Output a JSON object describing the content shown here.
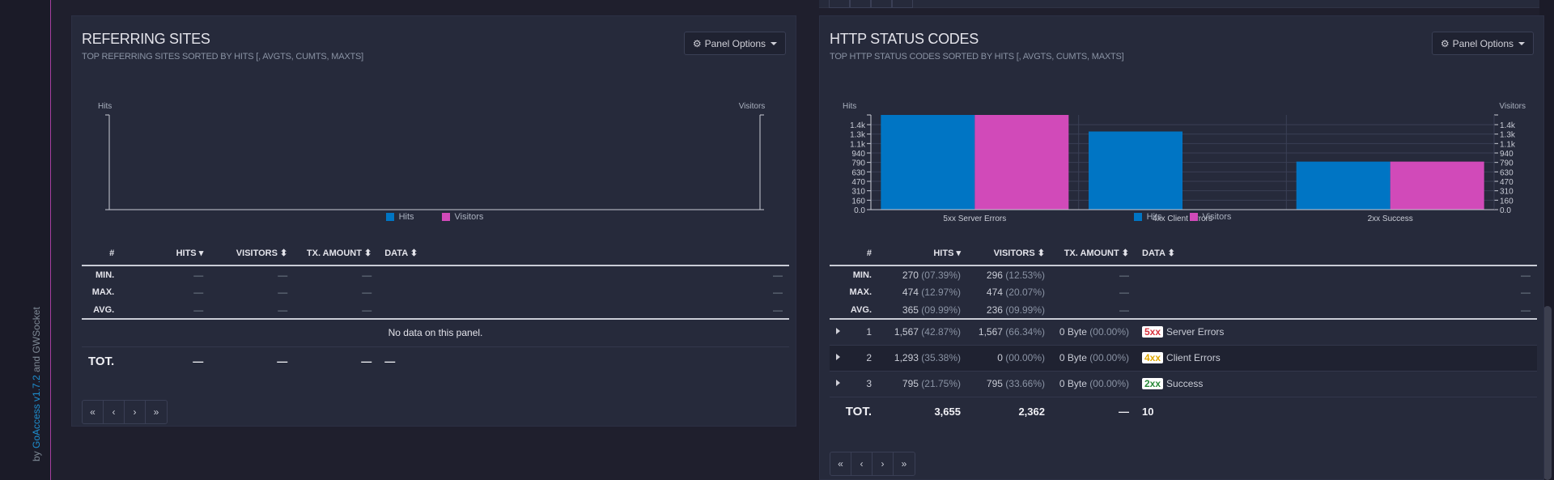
{
  "credit": {
    "prefix": "by ",
    "app": "GoAccess",
    "version": "v1.7.2",
    "and": " and ",
    "lib": "GWSocket"
  },
  "panel_options_label": "Panel Options",
  "colors": {
    "hits": "#0075c4",
    "visitors": "#d14ab9",
    "accent": "#a53fa0"
  },
  "pager": [
    "«",
    "‹",
    "›",
    "»"
  ],
  "referring": {
    "title": "REFERRING SITES",
    "subtitle": "TOP REFERRING SITES SORTED BY HITS [, AVGTS, CUMTS, MAXTS]",
    "axis_left": "Hits",
    "axis_right": "Visitors",
    "legend": [
      "Hits",
      "Visitors"
    ],
    "columns": [
      "#",
      "HITS",
      "VISITORS",
      "TX. AMOUNT",
      "DATA"
    ],
    "summary": [
      {
        "label": "MIN.",
        "hits": "—",
        "visitors": "—",
        "tx": "—",
        "end": "—"
      },
      {
        "label": "MAX.",
        "hits": "—",
        "visitors": "—",
        "tx": "—",
        "end": "—"
      },
      {
        "label": "AVG.",
        "hits": "—",
        "visitors": "—",
        "tx": "—",
        "end": "—"
      }
    ],
    "no_data": "No data on this panel.",
    "total": {
      "label": "TOT.",
      "hits": "—",
      "visitors": "—",
      "tx": "—",
      "data": "—"
    }
  },
  "http": {
    "title": "HTTP STATUS CODES",
    "subtitle": "TOP HTTP STATUS CODES SORTED BY HITS [, AVGTS, CUMTS, MAXTS]",
    "legend": [
      "Hits",
      "Visitors"
    ],
    "columns": [
      "#",
      "HITS",
      "VISITORS",
      "TX. AMOUNT",
      "DATA"
    ],
    "summary": [
      {
        "label": "MIN.",
        "hits": "270",
        "hits_pct": "(07.39%)",
        "visitors": "296",
        "visitors_pct": "(12.53%)",
        "tx": "—",
        "end": "—"
      },
      {
        "label": "MAX.",
        "hits": "474",
        "hits_pct": "(12.97%)",
        "visitors": "474",
        "visitors_pct": "(20.07%)",
        "tx": "—",
        "end": "—"
      },
      {
        "label": "AVG.",
        "hits": "365",
        "hits_pct": "(09.99%)",
        "visitors": "236",
        "visitors_pct": "(09.99%)",
        "tx": "—",
        "end": "—"
      }
    ],
    "rows": [
      {
        "num": "1",
        "hits": "1,567",
        "hits_pct": "(42.87%)",
        "visitors": "1,567",
        "visitors_pct": "(66.34%)",
        "tx": "0 Byte",
        "tx_pct": "(00.00%)",
        "badge": "5xx",
        "data": "Server Errors"
      },
      {
        "num": "2",
        "hits": "1,293",
        "hits_pct": "(35.38%)",
        "visitors": "0",
        "visitors_pct": "(00.00%)",
        "tx": "0 Byte",
        "tx_pct": "(00.00%)",
        "badge": "4xx",
        "data": "Client Errors"
      },
      {
        "num": "3",
        "hits": "795",
        "hits_pct": "(21.75%)",
        "visitors": "795",
        "visitors_pct": "(33.66%)",
        "tx": "0 Byte",
        "tx_pct": "(00.00%)",
        "badge": "2xx",
        "data": "Success"
      }
    ],
    "total": {
      "label": "TOT.",
      "hits": "3,655",
      "visitors": "2,362",
      "tx": "—",
      "data": "10"
    }
  },
  "chart_data": [
    {
      "type": "bar",
      "categories": [],
      "series": [
        {
          "name": "Hits",
          "values": []
        },
        {
          "name": "Visitors",
          "values": []
        }
      ],
      "title": "",
      "ylabel": "Hits",
      "y2label": "Visitors",
      "yticks": [],
      "legend": "bottom"
    },
    {
      "type": "bar",
      "categories": [
        "5xx Server Errors",
        "4xx Client Errors",
        "2xx Success"
      ],
      "series": [
        {
          "name": "Hits",
          "values": [
            1567,
            1293,
            795
          ]
        },
        {
          "name": "Visitors",
          "values": [
            1567,
            0,
            795
          ]
        }
      ],
      "title": "",
      "ylabel": "Hits",
      "y2label": "Visitors",
      "yticks": [
        "0.0",
        "160",
        "310",
        "470",
        "630",
        "790",
        "940",
        "1.1k",
        "1.3k",
        "1.4k"
      ],
      "ylim": [
        0,
        1567
      ],
      "grid": true,
      "legend": "bottom"
    }
  ]
}
